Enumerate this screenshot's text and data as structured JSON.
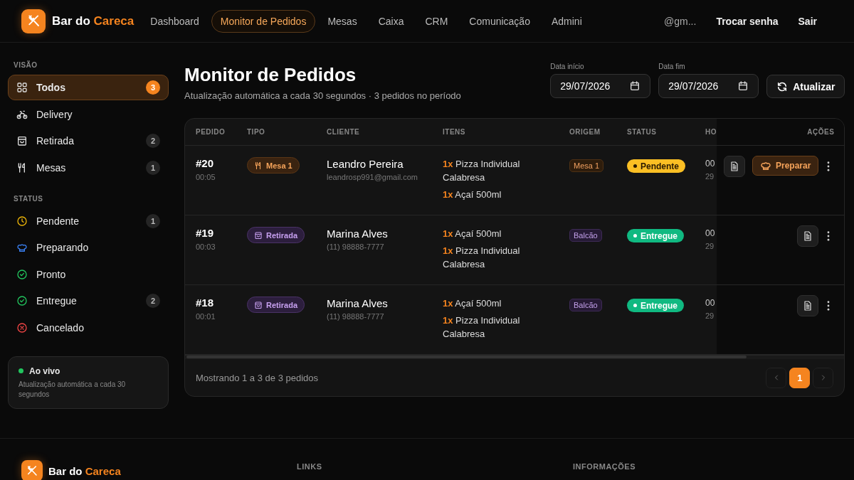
{
  "brand": {
    "name": "Bar do",
    "accent": "Careca"
  },
  "nav": [
    {
      "label": "Dashboard",
      "selected": false
    },
    {
      "label": "Monitor de Pedidos",
      "selected": true
    },
    {
      "label": "Mesas",
      "selected": false
    },
    {
      "label": "Caixa",
      "selected": false
    },
    {
      "label": "CRM",
      "selected": false
    },
    {
      "label": "Comunicação",
      "selected": false
    },
    {
      "label": "Admini",
      "selected": false
    }
  ],
  "user": {
    "email": "@gm...",
    "actions": [
      "Trocar senha",
      "Sair"
    ]
  },
  "sidebar": {
    "sections": [
      {
        "title": "VISÃO",
        "items": [
          {
            "kind": "grid",
            "label": "Todos",
            "count": "3",
            "selected": true
          },
          {
            "kind": "bike",
            "label": "Delivery",
            "selected": false
          },
          {
            "kind": "bag",
            "label": "Retirada",
            "count": "2",
            "selected": false
          },
          {
            "kind": "utensils",
            "label": "Mesas",
            "count": "1",
            "selected": false
          }
        ]
      },
      {
        "title": "STATUS",
        "items": [
          {
            "kind": "clock",
            "label": "Pendente",
            "count": "1",
            "selected": false
          },
          {
            "kind": "chef",
            "label": "Preparando",
            "selected": false
          },
          {
            "kind": "check",
            "label": "Pronto",
            "selected": false
          },
          {
            "kind": "check",
            "label": "Entregue",
            "count": "2",
            "selected": false
          },
          {
            "kind": "cross",
            "label": "Cancelado",
            "selected": false
          }
        ]
      }
    ],
    "live": {
      "title": "Ao vivo",
      "text": "Atualização automática a cada 30 segundos"
    }
  },
  "page": {
    "title": "Monitor de Pedidos",
    "subtitle": "Atualização automática a cada 30 segundos · 3 pedidos no período",
    "dates": [
      {
        "label": "Data início",
        "value": "29/07/2026"
      },
      {
        "label": "Data fim",
        "value": "29/07/2026"
      }
    ],
    "refresh": "Atualizar"
  },
  "table": {
    "columns": [
      "PEDIDO",
      "TIPO",
      "CLIENTE",
      "ITENS",
      "ORIGEM",
      "STATUS",
      "HO",
      "AÇÕES"
    ],
    "rows": [
      {
        "number": "#20",
        "time": "00:05",
        "type": {
          "kind": "mesa",
          "label": "Mesa 1"
        },
        "client": "Leandro Pereira",
        "contact": "leandrosp991@gmail.com",
        "items": [
          {
            "qty": "1x",
            "name": "Pizza Individual Calabresa"
          },
          {
            "qty": "1x",
            "name": "Açaí 500ml"
          }
        ],
        "origin": {
          "kind": "mesa",
          "label": "Mesa 1"
        },
        "status": {
          "kind": "pendente",
          "label": "Pendente"
        },
        "hour": [
          "00",
          "29"
        ],
        "action": "Preparar"
      },
      {
        "number": "#19",
        "time": "00:03",
        "type": {
          "kind": "retirada",
          "label": "Retirada"
        },
        "client": "Marina Alves",
        "contact": "(11) 98888-7777",
        "items": [
          {
            "qty": "1x",
            "name": "Açaí 500ml"
          },
          {
            "qty": "1x",
            "name": "Pizza Individual Calabresa"
          }
        ],
        "origin": {
          "kind": "balcao",
          "label": "Balcão"
        },
        "status": {
          "kind": "entregue",
          "label": "Entregue"
        },
        "hour": [
          "00",
          "29"
        ]
      },
      {
        "number": "#18",
        "time": "00:01",
        "type": {
          "kind": "retirada",
          "label": "Retirada"
        },
        "client": "Marina Alves",
        "contact": "(11) 98888-7777",
        "items": [
          {
            "qty": "1x",
            "name": "Açaí 500ml"
          },
          {
            "qty": "1x",
            "name": "Pizza Individual Calabresa"
          }
        ],
        "origin": {
          "kind": "balcao",
          "label": "Balcão"
        },
        "status": {
          "kind": "entregue",
          "label": "Entregue"
        },
        "hour": [
          "00",
          "29"
        ]
      }
    ],
    "summary": "Mostrando 1 a 3 de 3 pedidos",
    "pages": [
      {
        "label": "1",
        "selected": true
      }
    ]
  },
  "footer": {
    "brand": {
      "name": "Bar do",
      "accent": "Careca"
    },
    "headings": [
      "LINKS",
      "INFORMAÇÕES"
    ]
  }
}
